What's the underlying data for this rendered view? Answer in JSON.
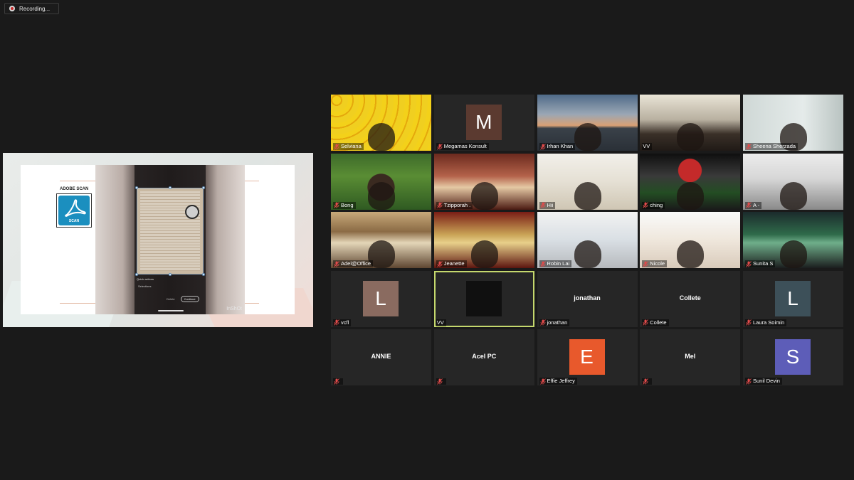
{
  "recording": {
    "label": "Recording..."
  },
  "share": {
    "slide_title": "ADOBE SCAN",
    "logo_label": "SCAN",
    "phone": {
      "quick_actions": "Quick actions",
      "quick_item": "Selections",
      "btn_secondary": "Delete",
      "btn_primary": "Continue"
    },
    "watermark": "InShOt"
  },
  "participants": [
    {
      "name": "Selviana",
      "type": "video",
      "scene": "emoji"
    },
    {
      "name": "Megamas Konsult",
      "type": "avatar",
      "initial": "M",
      "color": "#5b3a30"
    },
    {
      "name": "Irhan Khan",
      "type": "video",
      "scene": "bridge"
    },
    {
      "name": "VV",
      "type": "video",
      "scene": "room",
      "muted": false
    },
    {
      "name": "Sheena Sherzada",
      "type": "video",
      "scene": "wall"
    },
    {
      "name": "Bong",
      "type": "video",
      "scene": "jungle"
    },
    {
      "name": "Tzipporah .",
      "type": "video",
      "scene": "redroom"
    },
    {
      "name": "Hii",
      "type": "video",
      "scene": "shelves"
    },
    {
      "name": "ching",
      "type": "video",
      "scene": "stadium"
    },
    {
      "name": "A -",
      "type": "video",
      "scene": "office"
    },
    {
      "name": "Adel@Office",
      "type": "video",
      "scene": "japanese"
    },
    {
      "name": "Jeanette",
      "type": "video",
      "scene": "palace"
    },
    {
      "name": "Robin Lai",
      "type": "video",
      "scene": "whiteboard"
    },
    {
      "name": "Nicole",
      "type": "video",
      "scene": "shelves2"
    },
    {
      "name": "Sunita S",
      "type": "video",
      "scene": "aurora"
    },
    {
      "name": "vcfl",
      "type": "avatar",
      "initial": "L",
      "color": "#8a6b60"
    },
    {
      "name": "VV",
      "type": "blank",
      "active": true
    },
    {
      "name": "jonathan",
      "type": "text",
      "label": "jonathan"
    },
    {
      "name": "Collete",
      "type": "text",
      "label": "Collete"
    },
    {
      "name": "Laura Soimin",
      "type": "avatar",
      "initial": "L",
      "color": "#3d5059"
    },
    {
      "name": "ANNIE",
      "type": "text",
      "label": "ANNIE",
      "showName": false
    },
    {
      "name": "Acel PC",
      "type": "text",
      "label": "Acel PC",
      "showName": false
    },
    {
      "name": "Effie Jeffrey",
      "type": "avatar",
      "initial": "E",
      "color": "#e8592c"
    },
    {
      "name": "Mel",
      "type": "text",
      "label": "Mel",
      "showName": false
    },
    {
      "name": "Sunil Devin",
      "type": "avatar",
      "initial": "S",
      "color": "#5d5db8"
    }
  ],
  "colors": {
    "background": "#1a1a1a",
    "tile": "#262626",
    "active_border": "#c5d86d",
    "muted_mic": "#e04b4b"
  }
}
